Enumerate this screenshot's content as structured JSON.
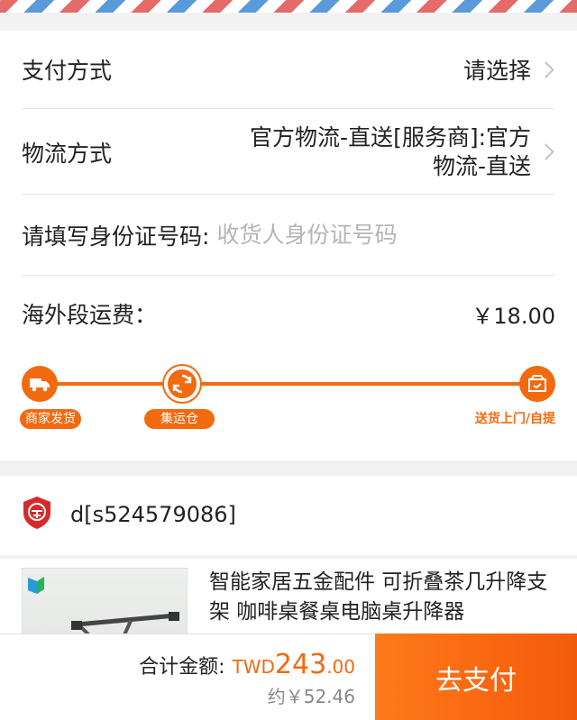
{
  "payment": {
    "label": "支付方式",
    "value": "请选择"
  },
  "logistics": {
    "label": "物流方式",
    "value_line1": "官方物流-直送[服务商]:官方",
    "value_line2": "物流-直送"
  },
  "id_field": {
    "label": "请填写身份证号码:",
    "placeholder": "收货人身份证号码"
  },
  "shipping_fee": {
    "label": "海外段运费：",
    "value": "￥18.00"
  },
  "tracking": {
    "steps": [
      {
        "label": "商家发货",
        "icon": "truck-icon"
      },
      {
        "label": "集运仓",
        "icon": "refresh-icon"
      },
      {
        "label": "送货上门/自提",
        "icon": "package-icon"
      }
    ],
    "accent_color": "#f26a10"
  },
  "shop": {
    "badge_icon": "enterprise-badge-icon",
    "name": "d[s524579086]"
  },
  "item": {
    "title": "智能家居五金配件 可折叠茶几升降支架 咖啡桌餐桌电脑桌升降器"
  },
  "footer": {
    "total_label": "合计金额:",
    "currency": "TWD",
    "amount_int": "243",
    "amount_dec": ".00",
    "approx": "约￥52.46",
    "pay_button": "去支付"
  }
}
